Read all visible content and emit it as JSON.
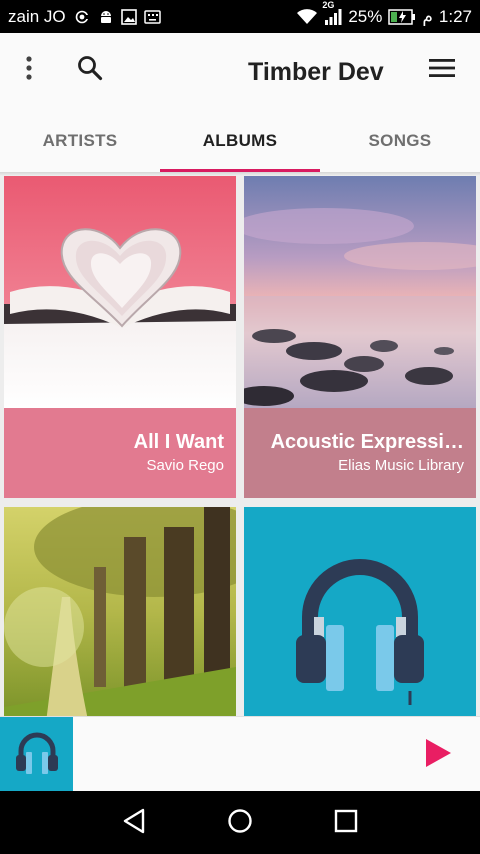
{
  "status_bar": {
    "carrier": "zain JO",
    "network_type": "2G",
    "battery": "25%",
    "ampm": "م",
    "time": "1:27",
    "icons": [
      "hotspot-icon",
      "android-icon",
      "image-icon",
      "keyboard-icon",
      "wifi-icon",
      "signal-icon",
      "battery-charging-icon"
    ]
  },
  "toolbar": {
    "title": "Timber Dev",
    "icons": [
      "more-vert-icon",
      "search-icon",
      "menu-icon"
    ]
  },
  "tabs": [
    {
      "label": "ARTISTS",
      "active": false
    },
    {
      "label": "ALBUMS",
      "active": true
    },
    {
      "label": "SONGS",
      "active": false
    }
  ],
  "albums": [
    {
      "title": "All I Want",
      "artist": "Savio Rego",
      "caption_color": "#e27a90",
      "art": "heart-book-photo"
    },
    {
      "title": "Acoustic Expressi…",
      "artist": "Elias Music Library",
      "caption_color": "#c27f8c",
      "art": "sunset-sea-photo"
    },
    {
      "title": "",
      "artist": "",
      "art": "forest-path-photo"
    },
    {
      "title": "",
      "artist": "",
      "art": "headphones-icon",
      "background": "#15a8c6"
    }
  ],
  "now_playing": {
    "art": "headphones-icon",
    "play_icon": "play-icon",
    "accent": "#e91e63"
  },
  "nav_bar": {
    "icons": [
      "back-icon",
      "home-icon",
      "recents-icon"
    ]
  }
}
